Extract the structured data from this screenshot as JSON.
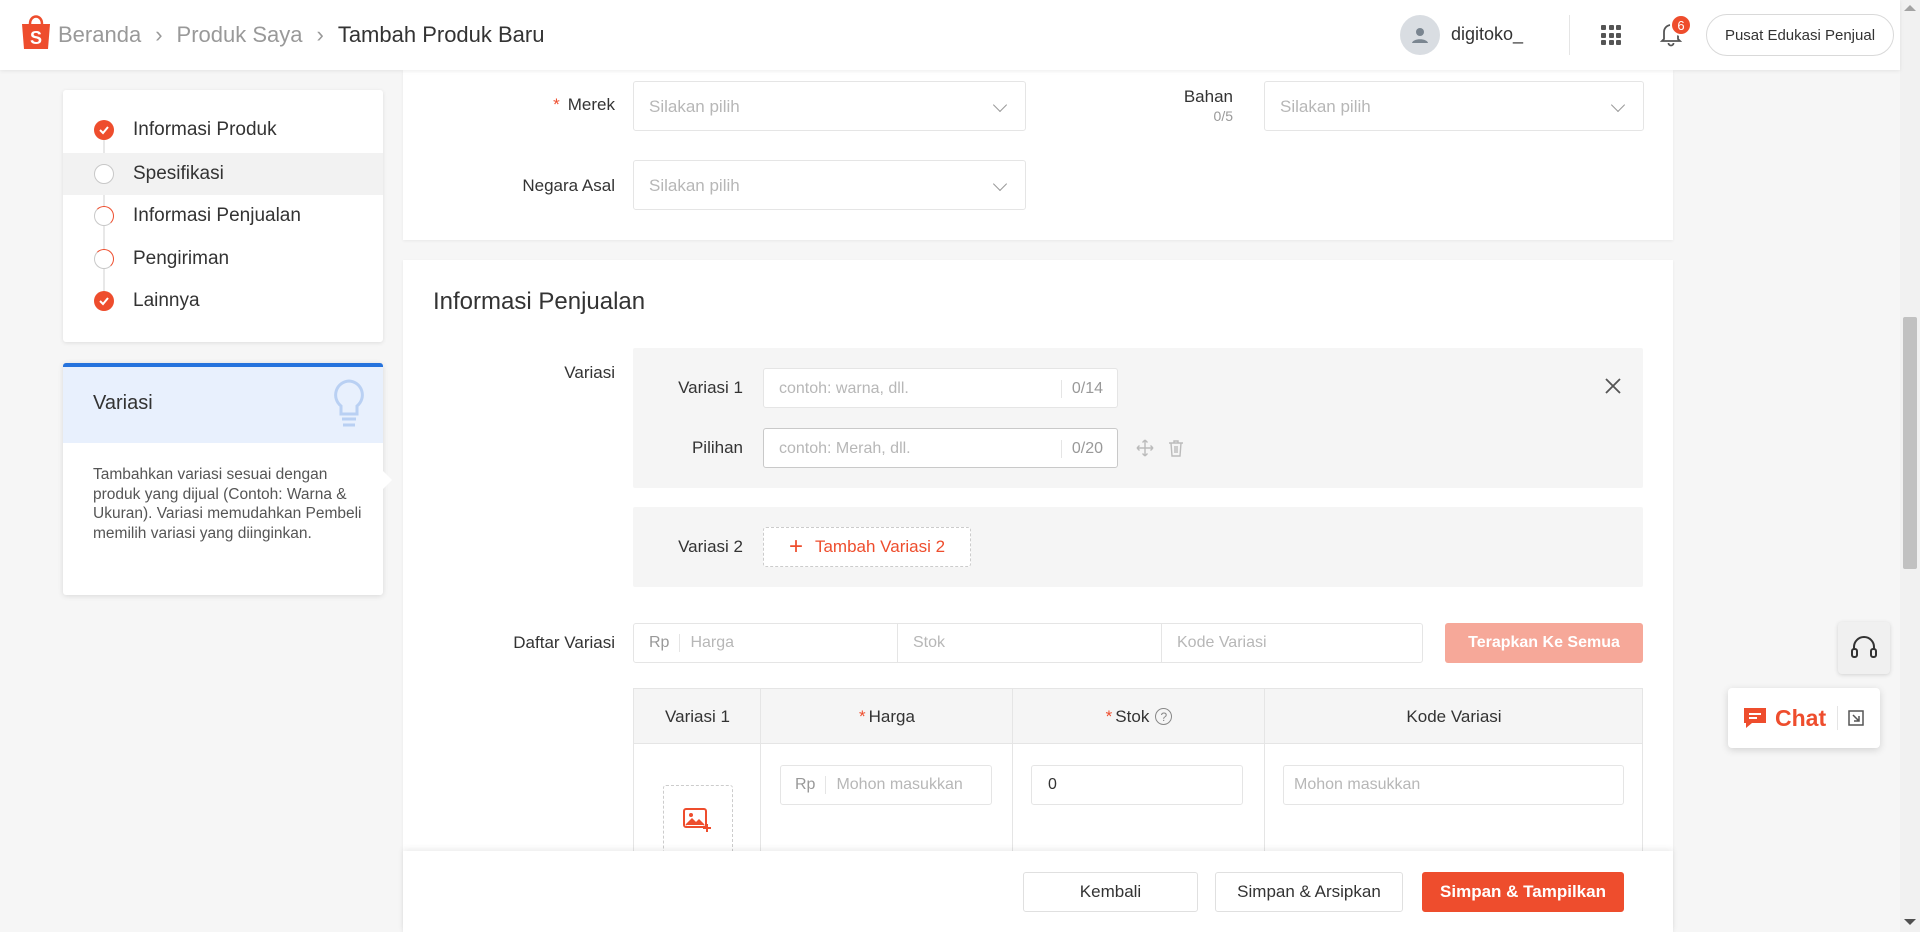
{
  "header": {
    "breadcrumbs": [
      "Beranda",
      "Produk Saya",
      "Tambah Produk Baru"
    ],
    "username": "digitoko_",
    "notification_count": "6",
    "edu_button": "Pusat Edukasi Penjual"
  },
  "nav": {
    "items": [
      {
        "label": "Informasi Produk",
        "status": "done"
      },
      {
        "label": "Spesifikasi",
        "status": "empty"
      },
      {
        "label": "Informasi Penjualan",
        "status": "partial"
      },
      {
        "label": "Pengiriman",
        "status": "partial"
      },
      {
        "label": "Lainnya",
        "status": "done"
      }
    ]
  },
  "tip": {
    "title": "Variasi",
    "text": "Tambahkan variasi sesuai dengan produk yang dijual (Contoh: Warna & Ukuran). Variasi memudahkan Pembeli memilih variasi yang diinginkan."
  },
  "spec": {
    "merek_label": "Merek",
    "merek_placeholder": "Silakan pilih",
    "bahan_label": "Bahan",
    "bahan_counter": "0/5",
    "bahan_placeholder": "Silakan pilih",
    "negara_label": "Negara Asal",
    "negara_placeholder": "Silakan pilih"
  },
  "sales": {
    "title": "Informasi Penjualan",
    "variasi_label": "Variasi",
    "variasi1_label": "Variasi 1",
    "variasi1_placeholder": "contoh: warna, dll.",
    "variasi1_counter": "0/14",
    "pilihan_label": "Pilihan",
    "pilihan_placeholder": "contoh: Merah, dll.",
    "pilihan_counter": "0/20",
    "variasi2_label": "Variasi 2",
    "add_variasi2": "Tambah Variasi 2",
    "daftar_label": "Daftar Variasi",
    "batch_rp": "Rp",
    "batch_harga": "Harga",
    "batch_stok": "Stok",
    "batch_kode": "Kode Variasi",
    "apply_all": "Terapkan Ke Semua",
    "table": {
      "headers": [
        "Variasi 1",
        "Harga",
        "Stok",
        "Kode Variasi"
      ],
      "row": {
        "harga_rp": "Rp",
        "harga_placeholder": "Mohon masukkan",
        "stok_value": "0",
        "kode_placeholder": "Mohon masukkan"
      }
    }
  },
  "footer": {
    "back": "Kembali",
    "save_archive": "Simpan & Arsipkan",
    "save_show": "Simpan & Tampilkan"
  },
  "floating": {
    "chat_label": "Chat"
  },
  "colors": {
    "accent": "#ee4d2d",
    "tip_border": "#2673dd",
    "tip_bg": "#e8f0fd",
    "apply_disabled": "#f6a899"
  }
}
